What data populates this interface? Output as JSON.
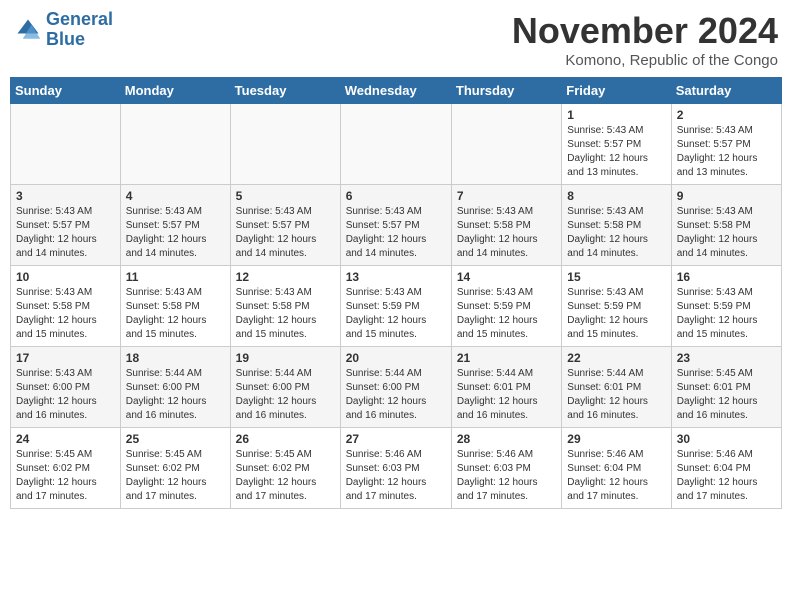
{
  "header": {
    "logo_line1": "General",
    "logo_line2": "Blue",
    "month_title": "November 2024",
    "location": "Komono, Republic of the Congo"
  },
  "weekdays": [
    "Sunday",
    "Monday",
    "Tuesday",
    "Wednesday",
    "Thursday",
    "Friday",
    "Saturday"
  ],
  "weeks": [
    [
      {
        "day": "",
        "content": ""
      },
      {
        "day": "",
        "content": ""
      },
      {
        "day": "",
        "content": ""
      },
      {
        "day": "",
        "content": ""
      },
      {
        "day": "",
        "content": ""
      },
      {
        "day": "1",
        "content": "Sunrise: 5:43 AM\nSunset: 5:57 PM\nDaylight: 12 hours\nand 13 minutes."
      },
      {
        "day": "2",
        "content": "Sunrise: 5:43 AM\nSunset: 5:57 PM\nDaylight: 12 hours\nand 13 minutes."
      }
    ],
    [
      {
        "day": "3",
        "content": "Sunrise: 5:43 AM\nSunset: 5:57 PM\nDaylight: 12 hours\nand 14 minutes."
      },
      {
        "day": "4",
        "content": "Sunrise: 5:43 AM\nSunset: 5:57 PM\nDaylight: 12 hours\nand 14 minutes."
      },
      {
        "day": "5",
        "content": "Sunrise: 5:43 AM\nSunset: 5:57 PM\nDaylight: 12 hours\nand 14 minutes."
      },
      {
        "day": "6",
        "content": "Sunrise: 5:43 AM\nSunset: 5:57 PM\nDaylight: 12 hours\nand 14 minutes."
      },
      {
        "day": "7",
        "content": "Sunrise: 5:43 AM\nSunset: 5:58 PM\nDaylight: 12 hours\nand 14 minutes."
      },
      {
        "day": "8",
        "content": "Sunrise: 5:43 AM\nSunset: 5:58 PM\nDaylight: 12 hours\nand 14 minutes."
      },
      {
        "day": "9",
        "content": "Sunrise: 5:43 AM\nSunset: 5:58 PM\nDaylight: 12 hours\nand 14 minutes."
      }
    ],
    [
      {
        "day": "10",
        "content": "Sunrise: 5:43 AM\nSunset: 5:58 PM\nDaylight: 12 hours\nand 15 minutes."
      },
      {
        "day": "11",
        "content": "Sunrise: 5:43 AM\nSunset: 5:58 PM\nDaylight: 12 hours\nand 15 minutes."
      },
      {
        "day": "12",
        "content": "Sunrise: 5:43 AM\nSunset: 5:58 PM\nDaylight: 12 hours\nand 15 minutes."
      },
      {
        "day": "13",
        "content": "Sunrise: 5:43 AM\nSunset: 5:59 PM\nDaylight: 12 hours\nand 15 minutes."
      },
      {
        "day": "14",
        "content": "Sunrise: 5:43 AM\nSunset: 5:59 PM\nDaylight: 12 hours\nand 15 minutes."
      },
      {
        "day": "15",
        "content": "Sunrise: 5:43 AM\nSunset: 5:59 PM\nDaylight: 12 hours\nand 15 minutes."
      },
      {
        "day": "16",
        "content": "Sunrise: 5:43 AM\nSunset: 5:59 PM\nDaylight: 12 hours\nand 15 minutes."
      }
    ],
    [
      {
        "day": "17",
        "content": "Sunrise: 5:43 AM\nSunset: 6:00 PM\nDaylight: 12 hours\nand 16 minutes."
      },
      {
        "day": "18",
        "content": "Sunrise: 5:44 AM\nSunset: 6:00 PM\nDaylight: 12 hours\nand 16 minutes."
      },
      {
        "day": "19",
        "content": "Sunrise: 5:44 AM\nSunset: 6:00 PM\nDaylight: 12 hours\nand 16 minutes."
      },
      {
        "day": "20",
        "content": "Sunrise: 5:44 AM\nSunset: 6:00 PM\nDaylight: 12 hours\nand 16 minutes."
      },
      {
        "day": "21",
        "content": "Sunrise: 5:44 AM\nSunset: 6:01 PM\nDaylight: 12 hours\nand 16 minutes."
      },
      {
        "day": "22",
        "content": "Sunrise: 5:44 AM\nSunset: 6:01 PM\nDaylight: 12 hours\nand 16 minutes."
      },
      {
        "day": "23",
        "content": "Sunrise: 5:45 AM\nSunset: 6:01 PM\nDaylight: 12 hours\nand 16 minutes."
      }
    ],
    [
      {
        "day": "24",
        "content": "Sunrise: 5:45 AM\nSunset: 6:02 PM\nDaylight: 12 hours\nand 17 minutes."
      },
      {
        "day": "25",
        "content": "Sunrise: 5:45 AM\nSunset: 6:02 PM\nDaylight: 12 hours\nand 17 minutes."
      },
      {
        "day": "26",
        "content": "Sunrise: 5:45 AM\nSunset: 6:02 PM\nDaylight: 12 hours\nand 17 minutes."
      },
      {
        "day": "27",
        "content": "Sunrise: 5:46 AM\nSunset: 6:03 PM\nDaylight: 12 hours\nand 17 minutes."
      },
      {
        "day": "28",
        "content": "Sunrise: 5:46 AM\nSunset: 6:03 PM\nDaylight: 12 hours\nand 17 minutes."
      },
      {
        "day": "29",
        "content": "Sunrise: 5:46 AM\nSunset: 6:04 PM\nDaylight: 12 hours\nand 17 minutes."
      },
      {
        "day": "30",
        "content": "Sunrise: 5:46 AM\nSunset: 6:04 PM\nDaylight: 12 hours\nand 17 minutes."
      }
    ]
  ]
}
